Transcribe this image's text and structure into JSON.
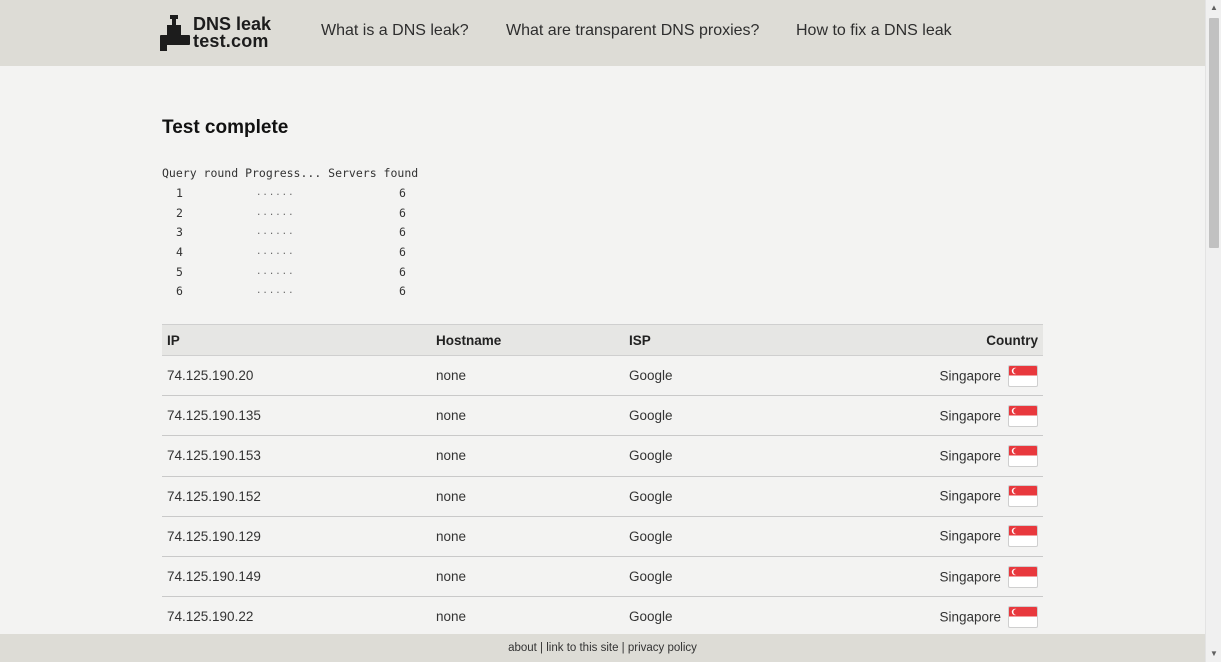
{
  "header": {
    "logo": {
      "line1": "DNS leak",
      "line2": "test.com"
    },
    "nav": [
      {
        "label": "What is a DNS leak?"
      },
      {
        "label": "What are transparent DNS proxies?"
      },
      {
        "label": "How to fix a DNS leak"
      }
    ]
  },
  "main": {
    "title": "Test complete",
    "query_header": "Query round Progress... Servers found",
    "rounds": [
      {
        "round": "1",
        "progress": "......",
        "servers": "6"
      },
      {
        "round": "2",
        "progress": "......",
        "servers": "6"
      },
      {
        "round": "3",
        "progress": "......",
        "servers": "6"
      },
      {
        "round": "4",
        "progress": "......",
        "servers": "6"
      },
      {
        "round": "5",
        "progress": "......",
        "servers": "6"
      },
      {
        "round": "6",
        "progress": "......",
        "servers": "6"
      }
    ],
    "table": {
      "headers": {
        "ip": "IP",
        "hostname": "Hostname",
        "isp": "ISP",
        "country": "Country"
      },
      "rows": [
        {
          "ip": "74.125.190.20",
          "hostname": "none",
          "isp": "Google",
          "country": "Singapore"
        },
        {
          "ip": "74.125.190.135",
          "hostname": "none",
          "isp": "Google",
          "country": "Singapore"
        },
        {
          "ip": "74.125.190.153",
          "hostname": "none",
          "isp": "Google",
          "country": "Singapore"
        },
        {
          "ip": "74.125.190.152",
          "hostname": "none",
          "isp": "Google",
          "country": "Singapore"
        },
        {
          "ip": "74.125.190.129",
          "hostname": "none",
          "isp": "Google",
          "country": "Singapore"
        },
        {
          "ip": "74.125.190.149",
          "hostname": "none",
          "isp": "Google",
          "country": "Singapore"
        },
        {
          "ip": "74.125.190.22",
          "hostname": "none",
          "isp": "Google",
          "country": "Singapore"
        }
      ]
    }
  },
  "footer": {
    "about": "about",
    "sep1": " | ",
    "link": "link to this site",
    "sep2": " | ",
    "privacy": "privacy policy"
  },
  "colors": {
    "header_bg": "#dddcd6",
    "page_bg": "#f3f3f2",
    "flag_red": "#e8383d"
  },
  "icons": {
    "logo": "faucet-icon",
    "flag": "singapore-flag-icon"
  }
}
